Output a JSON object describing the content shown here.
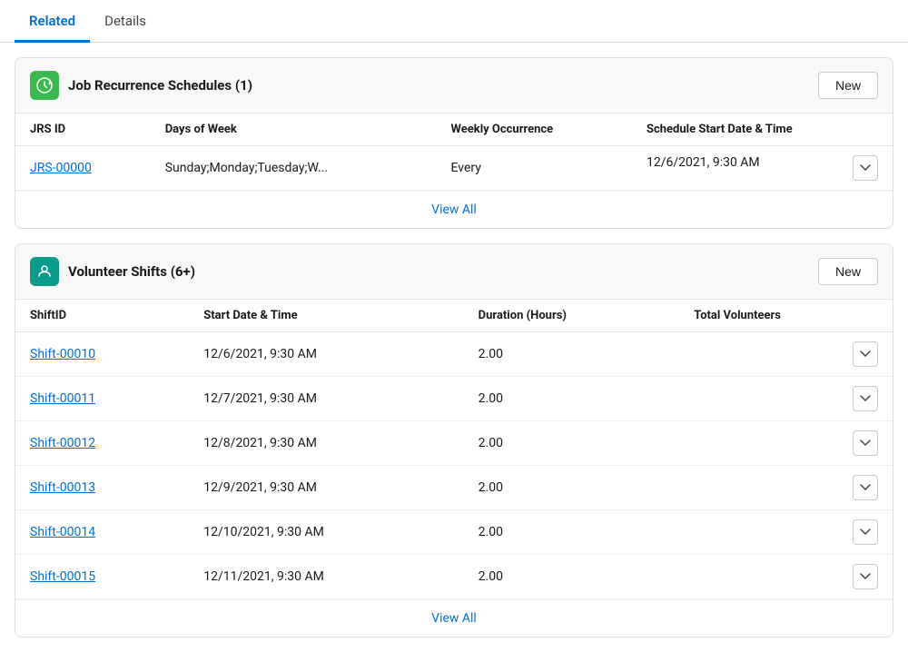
{
  "tabs": [
    {
      "id": "related",
      "label": "Related",
      "active": true
    },
    {
      "id": "details",
      "label": "Details",
      "active": false
    }
  ],
  "sections": [
    {
      "id": "job-recurrence",
      "icon": "recurrence-icon",
      "icon_color": "green",
      "title": "Job Recurrence Schedules (1)",
      "new_button_label": "New",
      "columns": [
        "JRS ID",
        "Days of Week",
        "Weekly Occurrence",
        "Schedule Start Date & Time"
      ],
      "rows": [
        {
          "id": "JRS-00000",
          "days_of_week": "Sunday;Monday;Tuesday;W...",
          "weekly_occurrence": "Every",
          "schedule_start": "12/6/2021, 9:30 AM",
          "has_dropdown": true
        }
      ],
      "view_all_label": "View All"
    },
    {
      "id": "volunteer-shifts",
      "icon": "volunteer-icon",
      "icon_color": "teal",
      "title": "Volunteer Shifts (6+)",
      "new_button_label": "New",
      "columns": [
        "ShiftID",
        "Start Date & Time",
        "Duration (Hours)",
        "Total Volunteers"
      ],
      "rows": [
        {
          "id": "Shift-00010",
          "start": "12/6/2021, 9:30 AM",
          "duration": "2.00",
          "volunteers": "",
          "has_dropdown": true
        },
        {
          "id": "Shift-00011",
          "start": "12/7/2021, 9:30 AM",
          "duration": "2.00",
          "volunteers": "",
          "has_dropdown": true
        },
        {
          "id": "Shift-00012",
          "start": "12/8/2021, 9:30 AM",
          "duration": "2.00",
          "volunteers": "",
          "has_dropdown": true
        },
        {
          "id": "Shift-00013",
          "start": "12/9/2021, 9:30 AM",
          "duration": "2.00",
          "volunteers": "",
          "has_dropdown": true
        },
        {
          "id": "Shift-00014",
          "start": "12/10/2021, 9:30 AM",
          "duration": "2.00",
          "volunteers": "",
          "has_dropdown": true
        },
        {
          "id": "Shift-00015",
          "start": "12/11/2021, 9:30 AM",
          "duration": "2.00",
          "volunteers": "",
          "has_dropdown": true
        }
      ],
      "view_all_label": "View All"
    }
  ]
}
